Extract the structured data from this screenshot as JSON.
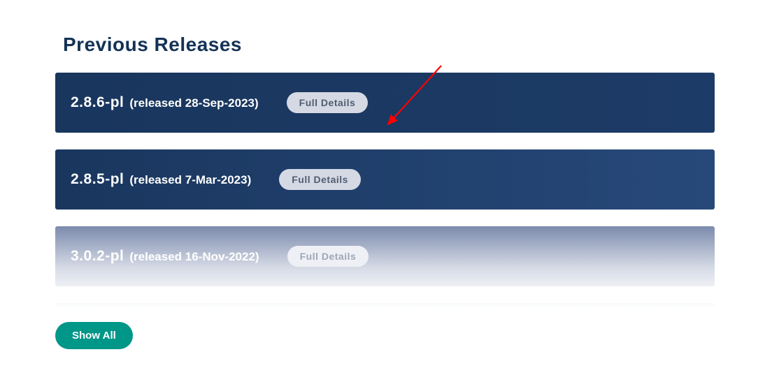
{
  "heading": "Previous Releases",
  "releases": [
    {
      "version": "2.8.6-pl",
      "date": "(released 28-Sep-2023)",
      "button": "Full Details"
    },
    {
      "version": "2.8.5-pl",
      "date": "(released 7-Mar-2023)",
      "button": "Full Details"
    },
    {
      "version": "3.0.2-pl",
      "date": "(released 16-Nov-2022)",
      "button": "Full Details"
    }
  ],
  "show_all": "Show All",
  "annotation": {
    "arrow_color": "#ff0000"
  }
}
